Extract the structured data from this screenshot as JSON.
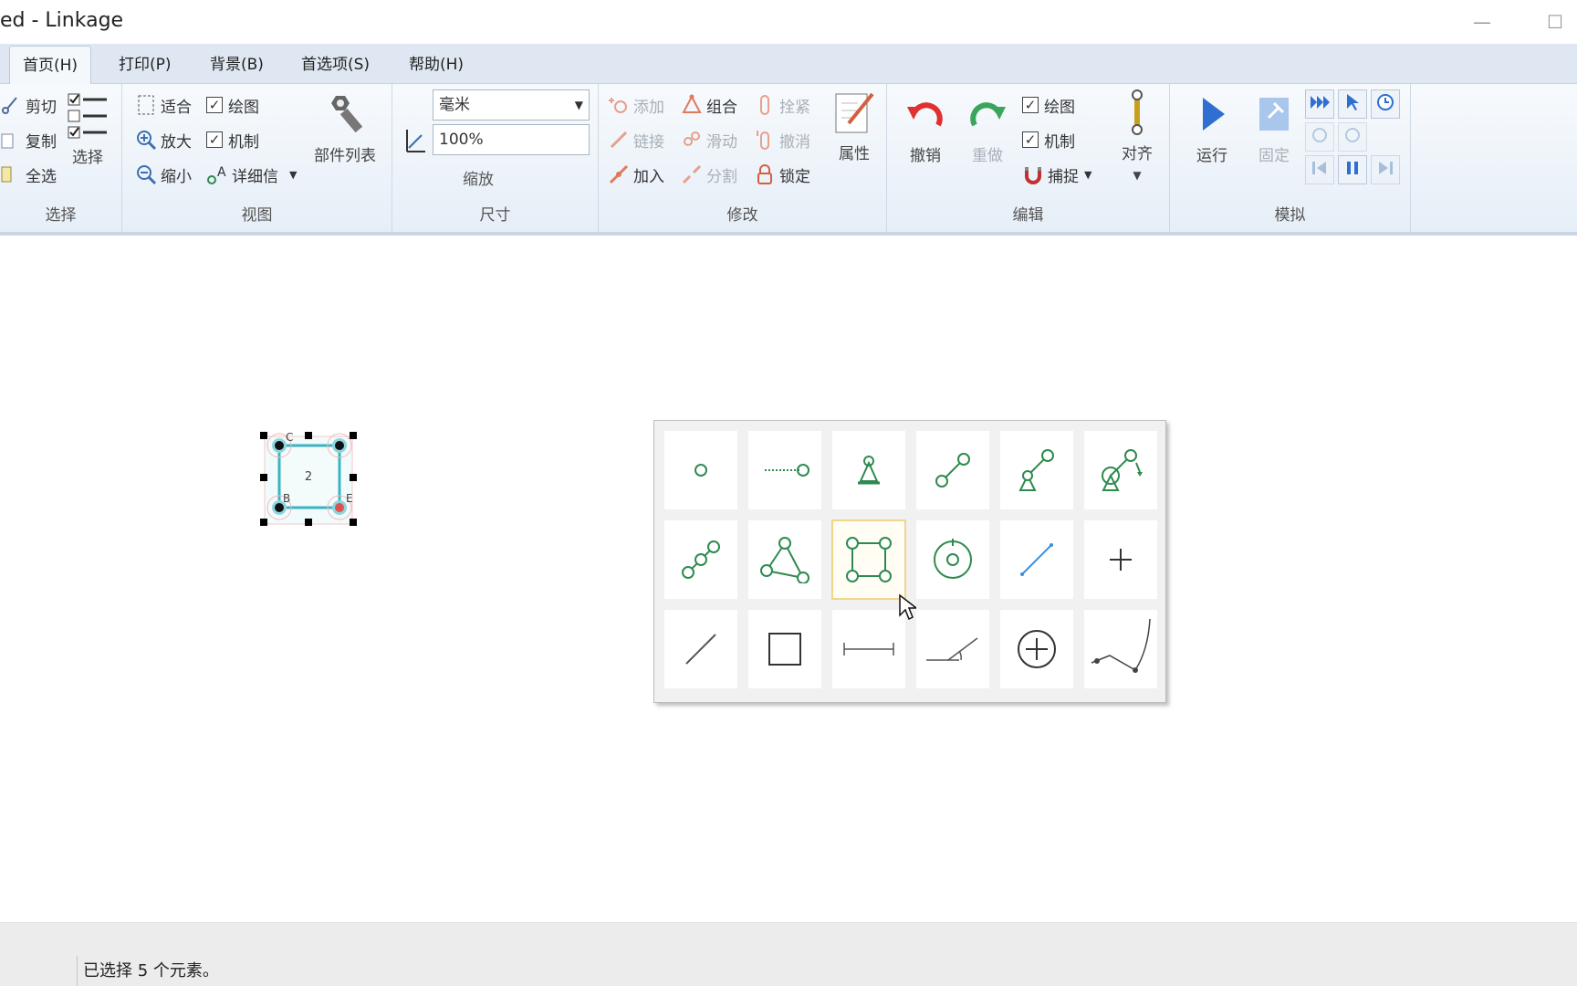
{
  "window": {
    "title": "ed - Linkage",
    "minimize_glyph": "—",
    "maximize_glyph": "☐"
  },
  "tabs": [
    {
      "label": "首页(H)",
      "active": true
    },
    {
      "label": "打印(P)"
    },
    {
      "label": "背景(B)"
    },
    {
      "label": "首选项(S)"
    },
    {
      "label": "帮助(H)"
    }
  ],
  "ribbon": {
    "select_group": {
      "label": "选择",
      "cut": "剪切",
      "copy": "复制",
      "select_all": "全选",
      "select": "选择"
    },
    "view_group": {
      "label": "视图",
      "fit": "适合",
      "zoom_in": "放大",
      "zoom_out": "缩小",
      "drawing": "绘图",
      "mechanism": "机制",
      "details": "详细信",
      "parts_list": "部件列表"
    },
    "size_group": {
      "label": "尺寸",
      "units_value": "毫米",
      "scale_value": "100%",
      "scale_label": "缩放"
    },
    "modify_group": {
      "label": "修改",
      "add": "添加",
      "combine": "组合",
      "fasten": "拴紧",
      "link": "链接",
      "slide": "滑动",
      "undo_fasten": "撤消",
      "join": "加入",
      "split": "分割",
      "lock": "锁定",
      "properties": "属性"
    },
    "edit_group": {
      "label": "编辑",
      "undo": "撤销",
      "redo": "重做",
      "drawing": "绘图",
      "mechanism": "机制",
      "snap": "捕捉",
      "align": "对齐"
    },
    "simulate_group": {
      "label": "模拟",
      "run": "运行",
      "pin": "固定"
    }
  },
  "canvas": {
    "selected_link": {
      "link_id": "2",
      "connectors": [
        "C",
        "B",
        "E"
      ]
    }
  },
  "palette": {
    "selected_index": 8,
    "items": [
      "connector-icon",
      "anchor-slider-icon",
      "anchor-icon",
      "link-icon",
      "anchored-link-icon",
      "motor-link-icon",
      "double-link-icon",
      "triangle-link-icon",
      "square-link-icon",
      "gear-icon",
      "line-icon",
      "cross-point-icon",
      "drawing-line-icon",
      "rectangle-icon",
      "measurement-icon",
      "angle-measure-icon",
      "circle-plus-icon",
      "curve-icon"
    ]
  },
  "status": {
    "message": "已选择 5 个元素。"
  },
  "colors": {
    "accent": "#2f8a4f",
    "selection": "#3bb3c3",
    "undo": "#e03030",
    "redo": "#3aa55c",
    "run": "#2e6fd0"
  }
}
